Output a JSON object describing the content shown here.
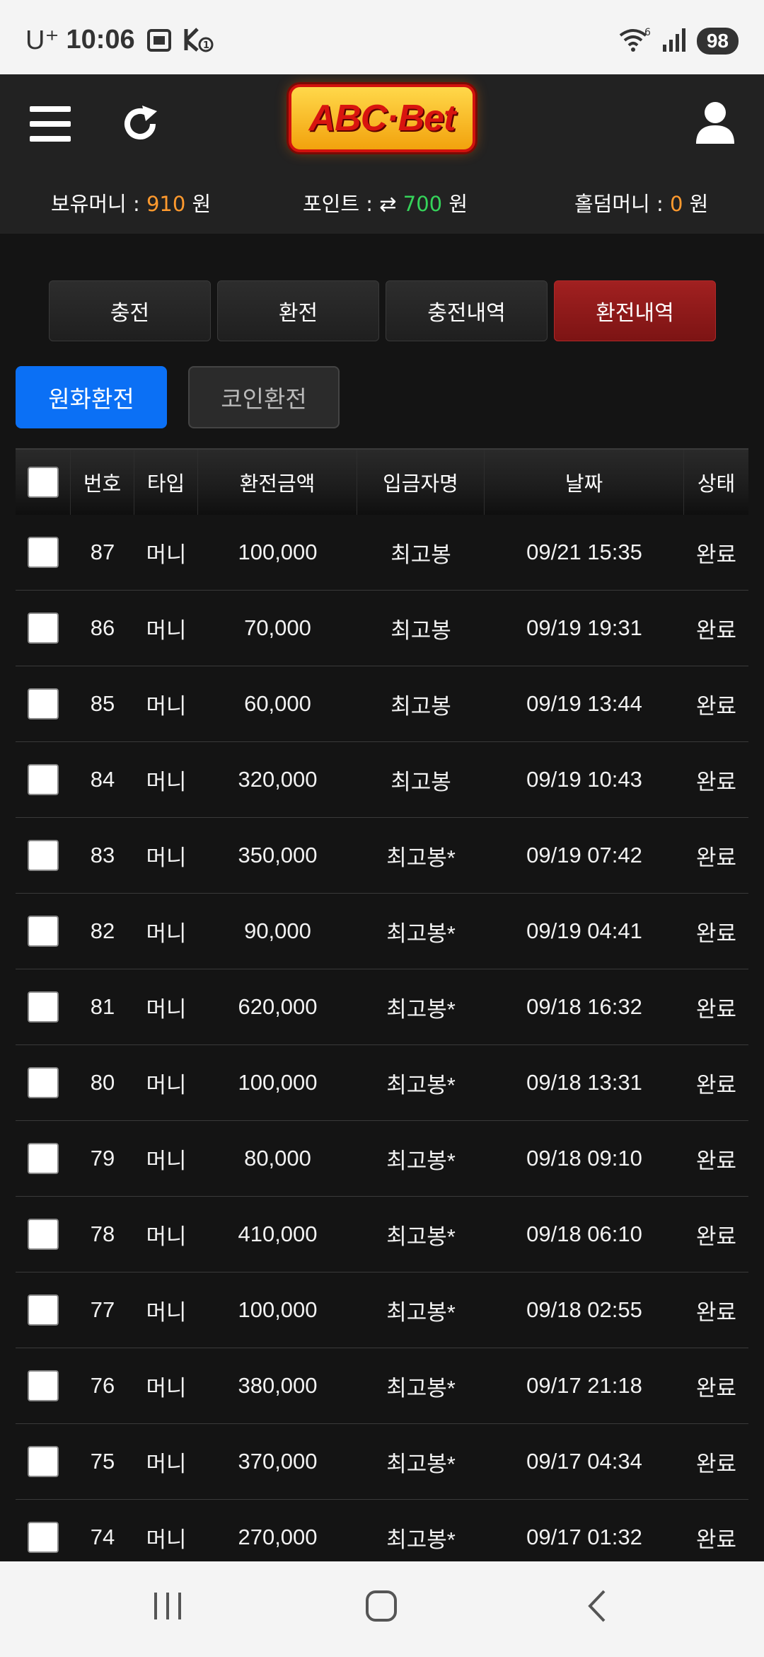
{
  "status_bar": {
    "carrier": "U⁺",
    "time": "10:06",
    "battery": "98",
    "wifi_badge": "6"
  },
  "header": {
    "logo_text": "ABC·Bet"
  },
  "balances": {
    "money_label": "보유머니 : ",
    "money_value": "910",
    "money_unit": " 원",
    "point_label": "포인트 : ",
    "point_icon": "⇄",
    "point_value": "700",
    "point_unit": " 원",
    "holdem_label": "홀덤머니 : ",
    "holdem_value": "0",
    "holdem_unit": " 원"
  },
  "tabs": [
    {
      "label": "충전",
      "active": false
    },
    {
      "label": "환전",
      "active": false
    },
    {
      "label": "충전내역",
      "active": false
    },
    {
      "label": "환전내역",
      "active": true
    }
  ],
  "subtabs": [
    {
      "label": "원화환전",
      "active": true
    },
    {
      "label": "코인환전",
      "active": false
    }
  ],
  "table": {
    "headers": [
      "번호",
      "타입",
      "환전금액",
      "입금자명",
      "날짜",
      "상태"
    ],
    "rows": [
      {
        "no": "87",
        "type": "머니",
        "amount": "100,000",
        "name": "최고봉",
        "date": "09/21 15:35",
        "status": "완료"
      },
      {
        "no": "86",
        "type": "머니",
        "amount": "70,000",
        "name": "최고봉",
        "date": "09/19 19:31",
        "status": "완료"
      },
      {
        "no": "85",
        "type": "머니",
        "amount": "60,000",
        "name": "최고봉",
        "date": "09/19 13:44",
        "status": "완료"
      },
      {
        "no": "84",
        "type": "머니",
        "amount": "320,000",
        "name": "최고봉",
        "date": "09/19 10:43",
        "status": "완료"
      },
      {
        "no": "83",
        "type": "머니",
        "amount": "350,000",
        "name": "최고봉*",
        "date": "09/19 07:42",
        "status": "완료"
      },
      {
        "no": "82",
        "type": "머니",
        "amount": "90,000",
        "name": "최고봉*",
        "date": "09/19 04:41",
        "status": "완료"
      },
      {
        "no": "81",
        "type": "머니",
        "amount": "620,000",
        "name": "최고봉*",
        "date": "09/18 16:32",
        "status": "완료"
      },
      {
        "no": "80",
        "type": "머니",
        "amount": "100,000",
        "name": "최고봉*",
        "date": "09/18 13:31",
        "status": "완료"
      },
      {
        "no": "79",
        "type": "머니",
        "amount": "80,000",
        "name": "최고봉*",
        "date": "09/18 09:10",
        "status": "완료"
      },
      {
        "no": "78",
        "type": "머니",
        "amount": "410,000",
        "name": "최고봉*",
        "date": "09/18 06:10",
        "status": "완료"
      },
      {
        "no": "77",
        "type": "머니",
        "amount": "100,000",
        "name": "최고봉*",
        "date": "09/18 02:55",
        "status": "완료"
      },
      {
        "no": "76",
        "type": "머니",
        "amount": "380,000",
        "name": "최고봉*",
        "date": "09/17 21:18",
        "status": "완료"
      },
      {
        "no": "75",
        "type": "머니",
        "amount": "370,000",
        "name": "최고봉*",
        "date": "09/17 04:34",
        "status": "완료"
      },
      {
        "no": "74",
        "type": "머니",
        "amount": "270,000",
        "name": "최고봉*",
        "date": "09/17 01:32",
        "status": "완료"
      }
    ]
  },
  "colors": {
    "accent_orange": "#ff9a2e",
    "accent_green": "#35d35a",
    "active_tab_red": "#a12020",
    "primary_blue": "#0b70f5"
  }
}
